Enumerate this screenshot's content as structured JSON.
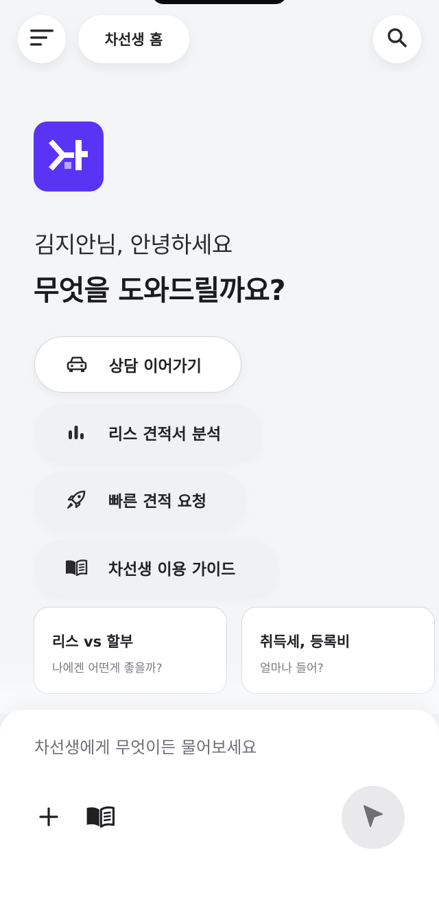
{
  "header": {
    "home_label": "차선생 홈",
    "menu_icon": "menu-icon",
    "search_icon": "search-icon"
  },
  "logo": {
    "icon": "chaseonsaeng-logo",
    "color": "#5a34f5"
  },
  "greeting": "김지안님, 안녕하세요",
  "headline": "무엇을 도와드릴까요?",
  "actions": [
    {
      "label": "상담 이어가기",
      "icon": "car-icon"
    },
    {
      "label": "리스 견적서 분석",
      "icon": "bar-chart-icon"
    },
    {
      "label": "빠른 견적 요청",
      "icon": "rocket-icon"
    },
    {
      "label": "차선생 이용 가이드",
      "icon": "book-icon"
    }
  ],
  "cards": [
    {
      "title": "리스 vs 할부",
      "subtitle": "나에겐 어떤게 좋을까?"
    },
    {
      "title": "취득세, 등록비",
      "subtitle": "얼마나 들어?"
    }
  ],
  "composer": {
    "placeholder": "차선생에게 무엇이든 물어보세요",
    "value": "",
    "plus_icon": "plus-icon",
    "book_icon": "book-icon",
    "send_icon": "send-icon"
  },
  "colors": {
    "accent": "#5a34f5",
    "background": "#f4f5f7",
    "send_bg": "#e9e9ec"
  }
}
